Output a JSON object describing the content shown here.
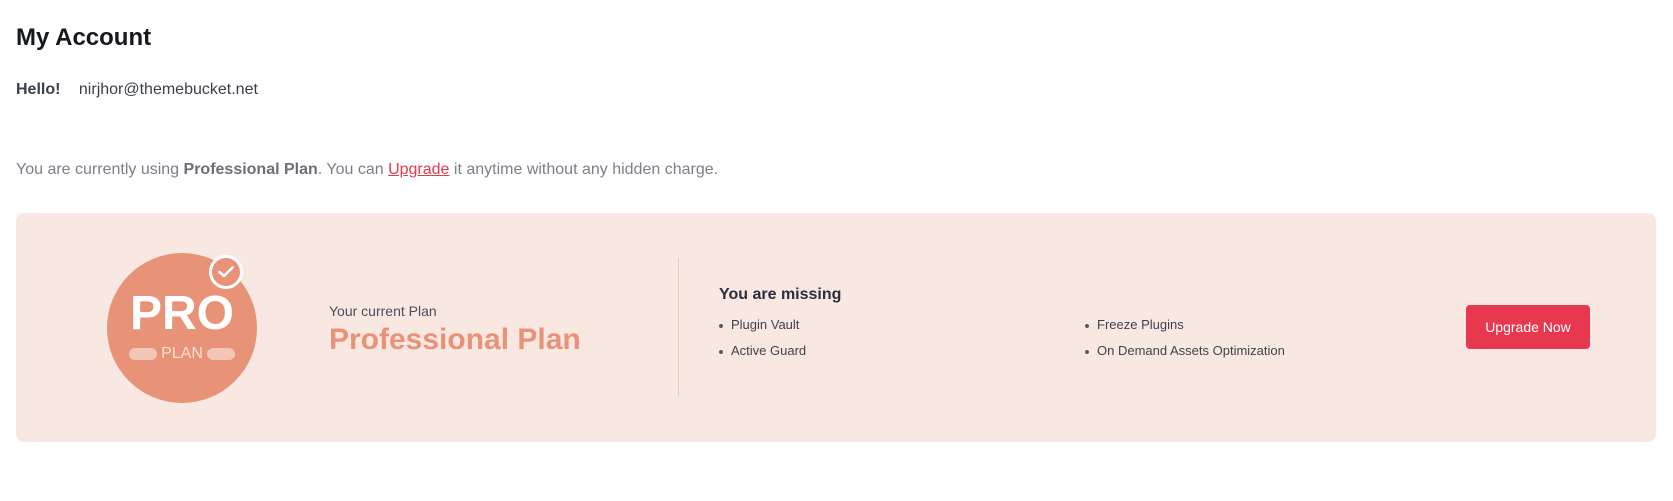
{
  "header": {
    "title": "My Account"
  },
  "greeting": {
    "hello": "Hello!",
    "email": "nirjhor@themebucket.net"
  },
  "plan_note": {
    "prefix": "You are currently using ",
    "plan_name": "Professional Plan",
    "middle": ". You can ",
    "link_label": "Upgrade",
    "suffix": " it anytime without any hidden charge."
  },
  "card": {
    "badge": {
      "title": "PRO",
      "subtitle": "PLAN",
      "icon": "check-icon"
    },
    "current_plan_label": "Your current Plan",
    "current_plan_name": "Professional Plan",
    "missing_title": "You are missing",
    "missing_features": [
      "Plugin Vault",
      "Freeze Plugins",
      "Active Guard",
      "On Demand Assets Optimization"
    ],
    "upgrade_button_label": "Upgrade Now"
  },
  "colors": {
    "accent": "#e8384f",
    "brand_orange": "#e89377",
    "card_background": "#f9e8e2"
  }
}
